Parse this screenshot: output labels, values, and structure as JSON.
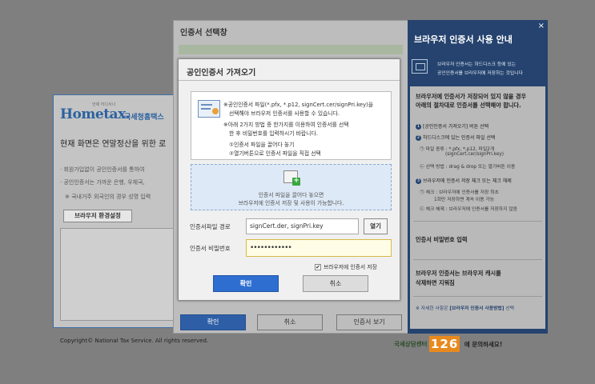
{
  "background": {
    "logo": {
      "brand": "Hometax.",
      "service": "국세청홈택스",
      "tagline": "언제 어디서나"
    },
    "headline": "현재 화면은 연말정산을 위한 로",
    "lines": [
      "· 회원가입없이 공인인증서를 통하여",
      "· 공인인증서는 가까운 은행, 우체국,",
      "※ 국내거주 외국인의 경우 성명 입력"
    ],
    "env_button": "브라우저 환경설정",
    "copyright": "Copyright© National Tax Service. All rights reserved."
  },
  "outer_window": {
    "title": "인증서 선택창",
    "buttons": {
      "confirm": "확인",
      "cancel": "취소",
      "view": "인증서 보기"
    }
  },
  "dialog": {
    "title": "공인인증서 가져오기",
    "info": [
      "※공인인증서 파일(*.pfx, *.p12, signCert.cer/signPri.key)을",
      "선택해야 브라우저 인증서를 사용할 수 있습니다.",
      "※아래 2가지 방법 중 한가지를 이용하여 인증서를 선택",
      "한 후 비밀번호를 입력하시기 바랍니다.",
      "①인증서 파일을 끌어다 놓기",
      "②열기버튼으로 인증서 파일을 직접 선택"
    ],
    "drop_zone": [
      "인증서 파일을 끌어다 놓으면",
      "브라우저에 인증서 저장 및 사용이 가능합니다."
    ],
    "path_label": "인증서파일 경로",
    "path_value": "signCert.der, signPri.key",
    "open_button": "열기",
    "pw_label": "인증서 비밀번호",
    "pw_value": "••••••••••••",
    "save_checkbox": "브라우저에 인증서 저장",
    "confirm": "확인",
    "cancel": "취소"
  },
  "guide": {
    "close": "×",
    "title": "브라우저 인증서 사용 안내",
    "top_text": [
      "브라우저 인증서는 하드디스크 등에 있는",
      "공인인증서를 브라우저에 저장하는 것입니다"
    ],
    "section1_head": [
      "브라우저에 인증서가 저장되어 있지 않을 경우",
      "아래의 절차대로 인증서를 선택해야 합니다."
    ],
    "steps": [
      {
        "num": "1",
        "text": "[공인인증서 가져오기] 버튼 선택"
      },
      {
        "num": "2",
        "text": "하드디스크에 있는 인증서 파일 선택"
      }
    ],
    "step2_sub": [
      "㉠ 파일 종류 : *.pfx, *.p12, 파일2개",
      "(signCert.cer/signPri.key)",
      "㉡ 선택 방법 : drag & drop 또는 열기버튼 이용"
    ],
    "step3": {
      "num": "3",
      "text": "브라우저에 인증서 저장 체크 또는 체크 해제"
    },
    "step3_sub": [
      "㉠ 체크 : 브라우저에 인증서를 저장 최초",
      "1회만 저장하면 계속 이용 가능",
      "㉡ 체크 해제 : 브라우저에 인증서를 저장하지 않음"
    ],
    "section2": "인증서 비밀번호 입력",
    "section3": [
      "브라우저 인증서는 브라우저 캐시를",
      "삭제하면 지워짐"
    ],
    "link_pre": "※ 자세한 사항은 ",
    "link_bold": "[브라우저 인증서 사용방법]",
    "link_post": " 선택"
  },
  "callcenter": {
    "pre": "국세상담센터",
    "number": "126",
    "post": "에 문의하세요!"
  },
  "colors": {
    "accent": "#2e6ed0",
    "guide_bg": "#25436e",
    "password_bg": "#fffde6"
  }
}
